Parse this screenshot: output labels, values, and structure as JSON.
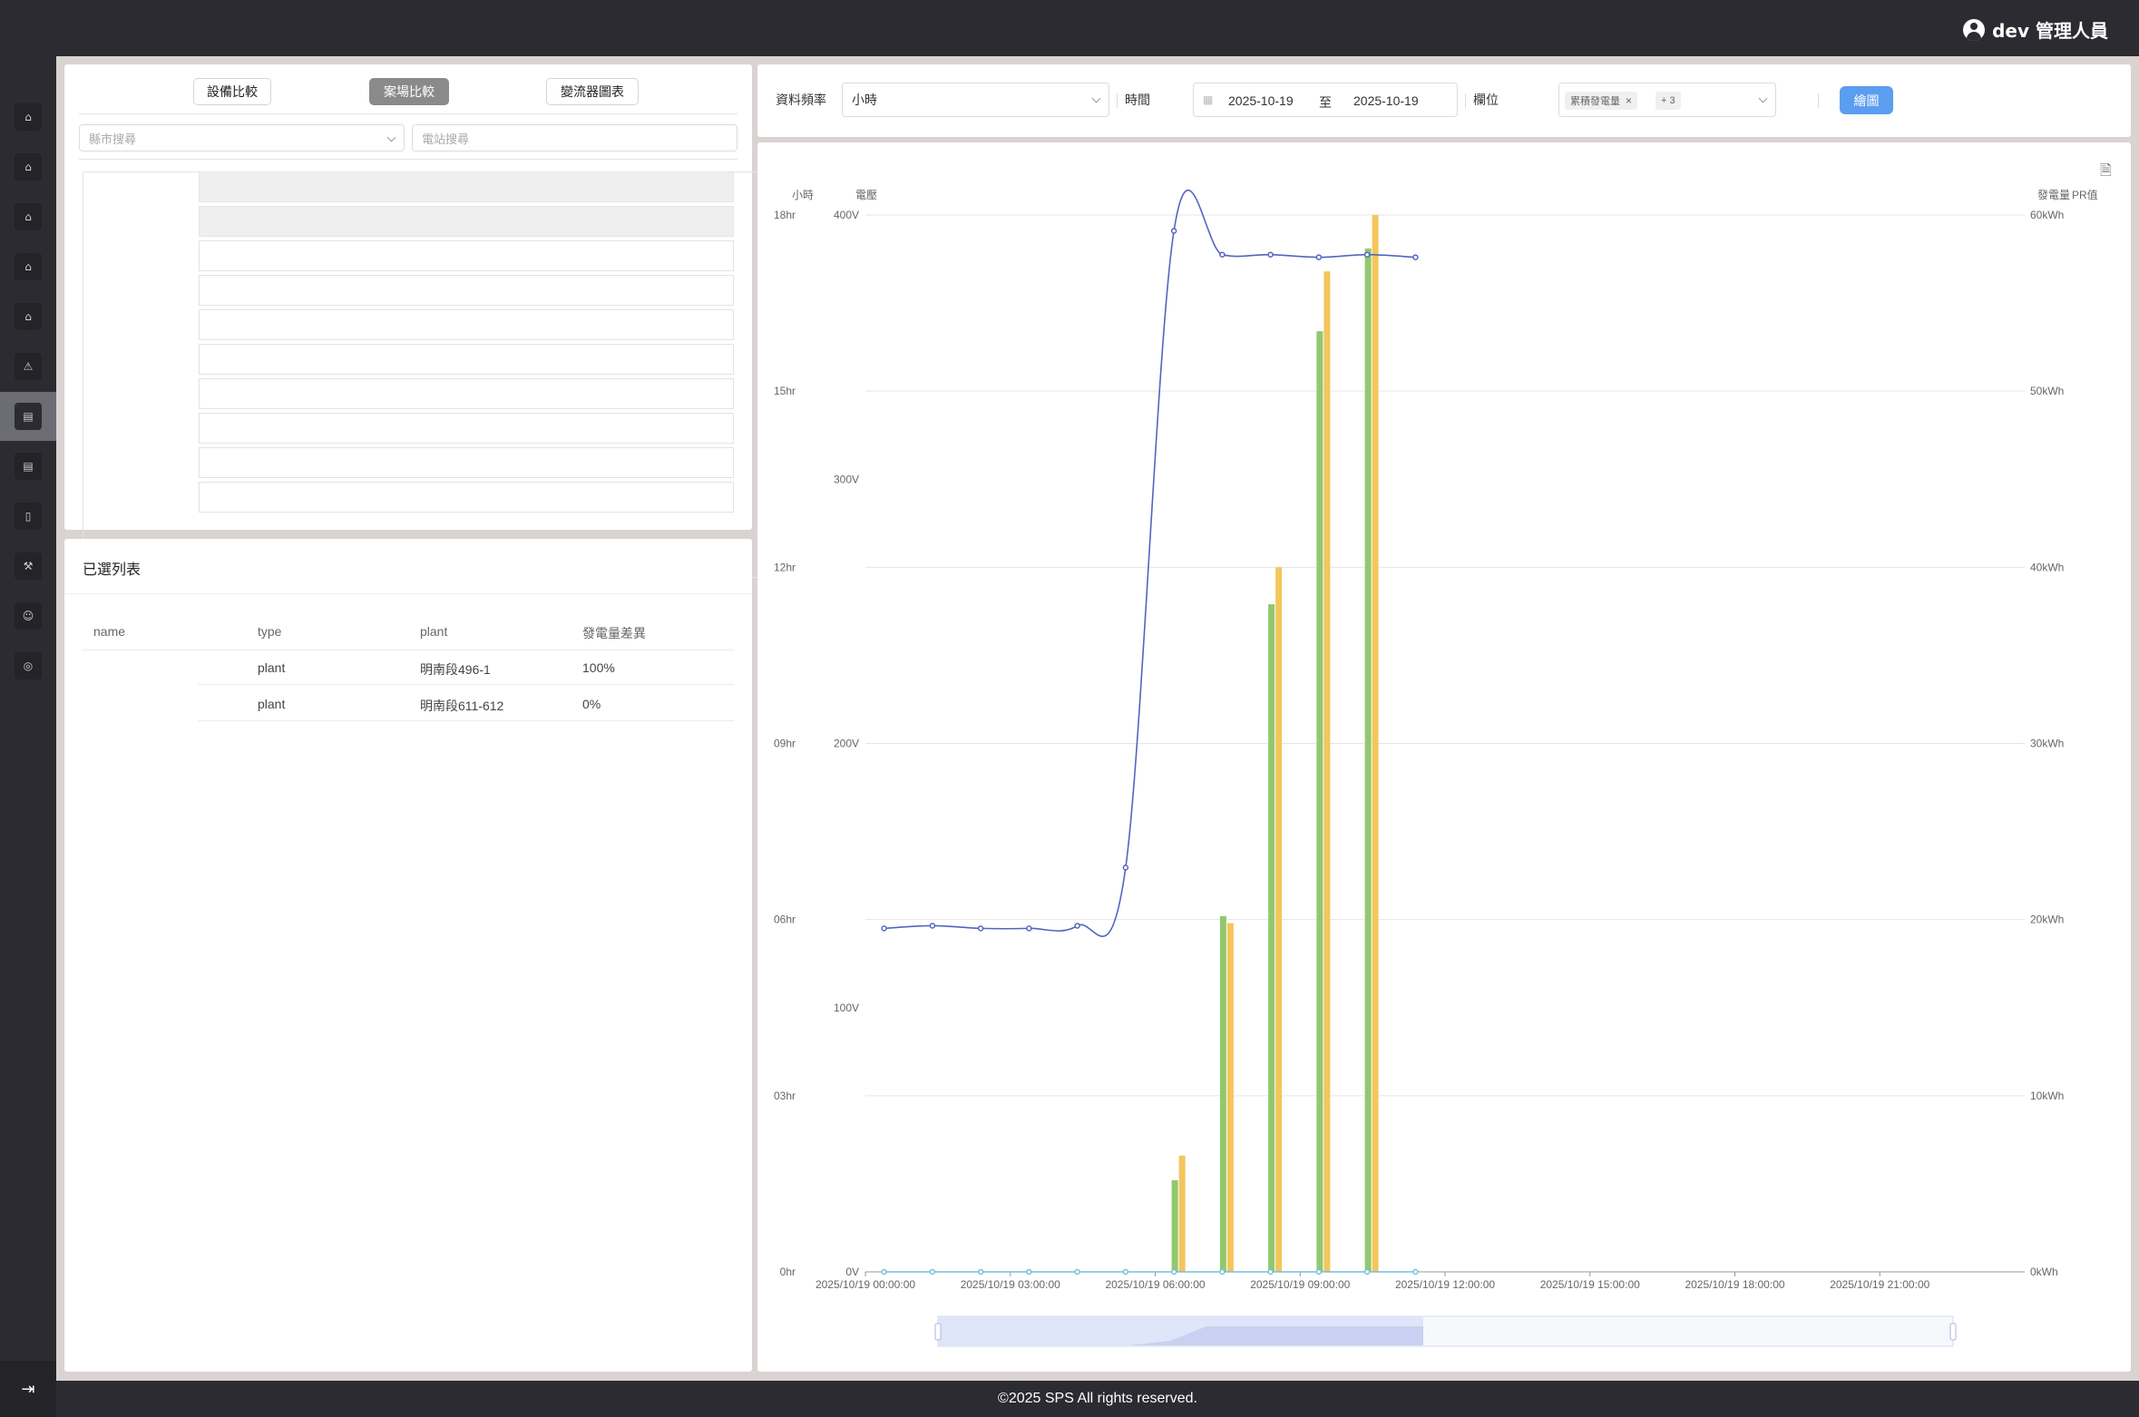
{
  "header": {
    "user_label": "dev 管理人員"
  },
  "sidebar": {
    "items": [
      {
        "icon": "building-icon",
        "glyph": "⌂"
      },
      {
        "icon": "building-icon",
        "glyph": "⌂"
      },
      {
        "icon": "building-icon",
        "glyph": "⌂"
      },
      {
        "icon": "building-icon",
        "glyph": "⌂"
      },
      {
        "icon": "building-icon",
        "glyph": "⌂"
      },
      {
        "icon": "warning-icon",
        "glyph": "⚠"
      },
      {
        "icon": "chart-icon",
        "glyph": "▤",
        "active": true
      },
      {
        "icon": "chart-icon",
        "glyph": "▤"
      },
      {
        "icon": "document-icon",
        "glyph": "▯"
      },
      {
        "icon": "wrench-icon",
        "glyph": "⚒"
      },
      {
        "icon": "user-icon",
        "glyph": "☺"
      },
      {
        "icon": "settings-icon",
        "glyph": "◎"
      }
    ],
    "toggle_glyph": "⇥"
  },
  "device_panel": {
    "tabs": [
      {
        "label": "設備比較",
        "active": false
      },
      {
        "label": "案場比較",
        "active": true
      },
      {
        "label": "變流器圖表",
        "active": false
      }
    ],
    "city_search_placeholder": "縣市搜尋",
    "station_search_placeholder": "電站搜尋"
  },
  "selected_panel": {
    "title": "已選列表",
    "columns": [
      "name",
      "type",
      "plant",
      "發電量差異"
    ],
    "rows": [
      {
        "name": "",
        "type": "plant",
        "plant": "明南段496-1",
        "diff": "100%"
      },
      {
        "name": "",
        "type": "plant",
        "plant": "明南段611-612",
        "diff": "0%"
      }
    ]
  },
  "filter": {
    "frequency_label": "資料頻率",
    "frequency_value": "小時",
    "time_label": "時間",
    "date_start": "2025-10-19",
    "date_to": "至",
    "date_end": "2025-10-19",
    "field_label": "欄位",
    "field_tag": "累積發電量",
    "field_more": "+ 3",
    "draw_button": "繪圖"
  },
  "chart_data": {
    "type": "bar",
    "axis_titles": {
      "hours": "小時",
      "voltage": "電壓",
      "energy": "發電量",
      "pr": "PR值"
    },
    "x_ticks": [
      "2025/10/19 00:00:00",
      "2025/10/19 03:00:00",
      "2025/10/19 06:00:00",
      "2025/10/19 09:00:00",
      "2025/10/19 12:00:00",
      "2025/10/19 15:00:00",
      "2025/10/19 18:00:00",
      "2025/10/19 21:00:00"
    ],
    "x_hours": [
      0,
      24
    ],
    "hours_ticks": [
      "0hr",
      "03hr",
      "06hr",
      "09hr",
      "12hr",
      "15hr",
      "18hr"
    ],
    "voltage_ticks": [
      "0V",
      "100V",
      "200V",
      "300V",
      "400V"
    ],
    "energy_ticks": [
      "0kWh",
      "10kWh",
      "20kWh",
      "30kWh",
      "40kWh",
      "50kWh",
      "60kWh"
    ],
    "ylim_voltage": [
      0,
      400
    ],
    "ylim_energy": [
      0,
      60000
    ],
    "series": [
      {
        "kind": "bar",
        "color": "#91c86f",
        "axis": "energy",
        "points": [
          [
            6,
            5200
          ],
          [
            7,
            20200
          ],
          [
            8,
            37900
          ],
          [
            9,
            53400
          ],
          [
            10,
            58100
          ]
        ]
      },
      {
        "kind": "bar",
        "color": "#f4c65c",
        "axis": "energy",
        "points": [
          [
            6,
            6600
          ],
          [
            7,
            19800
          ],
          [
            8,
            40000
          ],
          [
            9,
            56800
          ],
          [
            10,
            60000
          ]
        ]
      },
      {
        "kind": "line",
        "color": "#5265c0",
        "axis": "voltage",
        "points": [
          [
            0,
            130
          ],
          [
            1,
            131
          ],
          [
            2,
            130
          ],
          [
            3,
            130
          ],
          [
            4,
            131
          ],
          [
            5,
            153
          ],
          [
            6,
            394
          ],
          [
            7,
            385
          ],
          [
            8,
            385
          ],
          [
            9,
            384
          ],
          [
            10,
            385
          ],
          [
            11,
            384
          ]
        ]
      },
      {
        "kind": "line",
        "color": "#73c0de",
        "axis": "voltage",
        "points": [
          [
            0,
            0
          ],
          [
            1,
            0
          ],
          [
            2,
            0
          ],
          [
            3,
            0
          ],
          [
            4,
            0
          ],
          [
            5,
            0
          ],
          [
            6,
            0
          ],
          [
            7,
            0
          ],
          [
            8,
            0
          ],
          [
            9,
            0
          ],
          [
            10,
            0
          ],
          [
            11,
            0
          ]
        ]
      }
    ],
    "grid": true
  },
  "footer": {
    "copyright": "©2025 SPS All rights reserved."
  }
}
